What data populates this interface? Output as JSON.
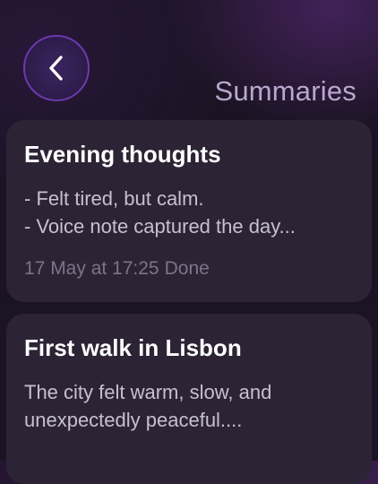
{
  "header": {
    "back_icon": "chevron-left-icon",
    "title": "Summaries"
  },
  "colors": {
    "accent_ring": "#6c39ae",
    "card_background": "#2c2435",
    "title_text": "#b9a7cf"
  },
  "summaries": [
    {
      "title": "Evening thoughts",
      "lines": [
        "- Felt tired, but calm.",
        "- Voice note captured the day..."
      ],
      "date": "17 May at 17:25",
      "status": "Done"
    },
    {
      "title": "First walk in Lisbon",
      "lines": [
        "The city felt warm, slow, and",
        "unexpectedly peaceful...."
      ]
    }
  ]
}
